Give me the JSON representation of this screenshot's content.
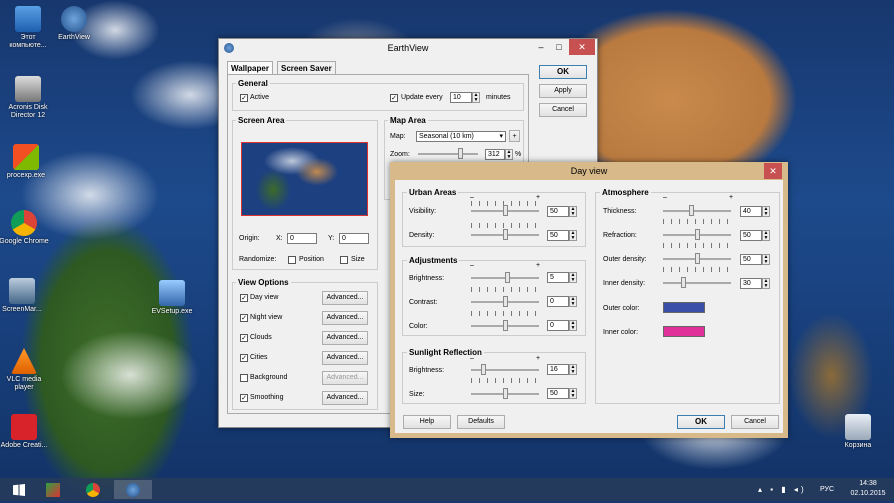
{
  "desktop": {
    "icons": [
      {
        "label": "Этот компьюте...",
        "icon": "computer-icon"
      },
      {
        "label": "EarthView",
        "icon": "earthview-icon"
      },
      {
        "label": "Acronis Disk Director 12",
        "icon": "acronis-icon"
      },
      {
        "label": "procexp.exe",
        "icon": "procexp-icon"
      },
      {
        "label": "Google Chrome",
        "icon": "chrome-icon"
      },
      {
        "label": "ScreenMar...",
        "icon": "screenmarker-icon"
      },
      {
        "label": "EVSetup.exe",
        "icon": "evsetup-icon"
      },
      {
        "label": "VLC media player",
        "icon": "vlc-icon"
      },
      {
        "label": "Adobe Creati...",
        "icon": "adobe-icon"
      },
      {
        "label": "Корзина",
        "icon": "recycle-bin-icon"
      }
    ]
  },
  "earthview": {
    "title": "EarthView",
    "tabs": [
      "Wallpaper",
      "Screen Saver"
    ],
    "buttons": {
      "ok": "OK",
      "apply": "Apply",
      "cancel": "Cancel"
    },
    "general": {
      "heading": "General",
      "active_label": "Active",
      "update_label": "Update every",
      "update_value": "10",
      "minutes_label": "minutes"
    },
    "screen_area": {
      "heading": "Screen Area",
      "origin_label": "Origin:",
      "x_label": "X:",
      "x_value": "0",
      "y_label": "Y:",
      "y_value": "0",
      "randomize_label": "Randomize:",
      "position_label": "Position",
      "size_label": "Size"
    },
    "map_area": {
      "heading": "Map Area",
      "map_label": "Map:",
      "map_value": "Seasonal (10 km)",
      "plus_label": "+",
      "zoom_label": "Zoom:",
      "zoom_value": "312",
      "zoom_unit": "%"
    },
    "view_options": {
      "heading": "View Options",
      "advanced_label": "Advanced...",
      "items": [
        {
          "label": "Day view",
          "checked": true
        },
        {
          "label": "Night view",
          "checked": true
        },
        {
          "label": "Clouds",
          "checked": true
        },
        {
          "label": "Cities",
          "checked": true
        },
        {
          "label": "Background",
          "checked": false
        },
        {
          "label": "Smoothing",
          "checked": true
        }
      ]
    }
  },
  "dayview": {
    "title": "Day view",
    "urban": {
      "heading": "Urban Areas",
      "visibility_label": "Visibility:",
      "visibility_value": "50",
      "density_label": "Density:",
      "density_value": "50"
    },
    "adjustments": {
      "heading": "Adjustments",
      "brightness_label": "Brightness:",
      "brightness_value": "5",
      "contrast_label": "Contrast:",
      "contrast_value": "0",
      "color_label": "Color:",
      "color_value": "0"
    },
    "sunlight": {
      "heading": "Sunlight Reflection",
      "brightness_label": "Brightness:",
      "brightness_value": "16",
      "size_label": "Size:",
      "size_value": "50"
    },
    "atmosphere": {
      "heading": "Atmosphere",
      "thickness_label": "Thickness:",
      "thickness_value": "40",
      "refraction_label": "Refraction:",
      "refraction_value": "50",
      "outer_density_label": "Outer density:",
      "outer_density_value": "50",
      "inner_density_label": "Inner density:",
      "inner_density_value": "30",
      "outer_color_label": "Outer color:",
      "outer_color": "#3a4fa8",
      "inner_color_label": "Inner color:",
      "inner_color": "#e0309a"
    },
    "plus_sign": "+",
    "minus_sign": "–",
    "buttons": {
      "help": "Help",
      "defaults": "Defaults",
      "ok": "OK",
      "cancel": "Cancel"
    }
  },
  "taskbar": {
    "language": "РУС",
    "time": "14:38",
    "date": "02.10.2015"
  }
}
